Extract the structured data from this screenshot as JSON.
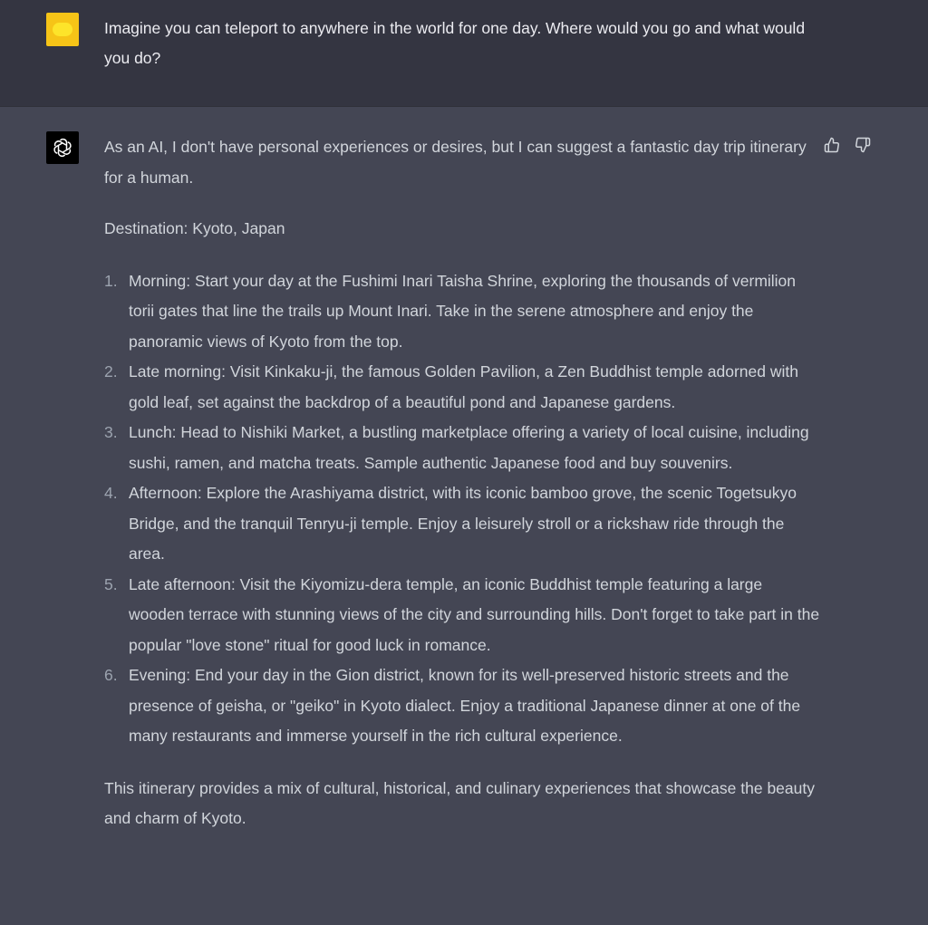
{
  "user_message": {
    "text": "Imagine you can teleport to anywhere in the world for one day. Where would you go and what would you do?"
  },
  "assistant_message": {
    "intro": "As an AI, I don't have personal experiences or desires, but I can suggest a fantastic day trip itinerary for a human.",
    "destination": "Destination: Kyoto, Japan",
    "items": [
      {
        "num": "1.",
        "text": "Morning: Start your day at the Fushimi Inari Taisha Shrine, exploring the thousands of vermilion torii gates that line the trails up Mount Inari. Take in the serene atmosphere and enjoy the panoramic views of Kyoto from the top."
      },
      {
        "num": "2.",
        "text": "Late morning: Visit Kinkaku-ji, the famous Golden Pavilion, a Zen Buddhist temple adorned with gold leaf, set against the backdrop of a beautiful pond and Japanese gardens."
      },
      {
        "num": "3.",
        "text": "Lunch: Head to Nishiki Market, a bustling marketplace offering a variety of local cuisine, including sushi, ramen, and matcha treats. Sample authentic Japanese food and buy souvenirs."
      },
      {
        "num": "4.",
        "text": "Afternoon: Explore the Arashiyama district, with its iconic bamboo grove, the scenic Togetsukyo Bridge, and the tranquil Tenryu-ji temple. Enjoy a leisurely stroll or a rickshaw ride through the area."
      },
      {
        "num": "5.",
        "text": "Late afternoon: Visit the Kiyomizu-dera temple, an iconic Buddhist temple featuring a large wooden terrace with stunning views of the city and surrounding hills. Don't forget to take part in the popular \"love stone\" ritual for good luck in romance."
      },
      {
        "num": "6.",
        "text": "Evening: End your day in the Gion district, known for its well-preserved historic streets and the presence of geisha, or \"geiko\" in Kyoto dialect. Enjoy a traditional Japanese dinner at one of the many restaurants and immerse yourself in the rich cultural experience."
      }
    ],
    "outro": "This itinerary provides a mix of cultural, historical, and culinary experiences that showcase the beauty and charm of Kyoto."
  },
  "icons": {
    "user_avatar": "yellow-avatar",
    "assistant_avatar": "openai-logo-icon",
    "thumbs_up": "thumbs-up-icon",
    "thumbs_down": "thumbs-down-icon"
  },
  "colors": {
    "user_row_bg": "#343541",
    "assistant_row_bg": "#444654",
    "text": "#d1d5db",
    "user_avatar": "#f6c417"
  }
}
